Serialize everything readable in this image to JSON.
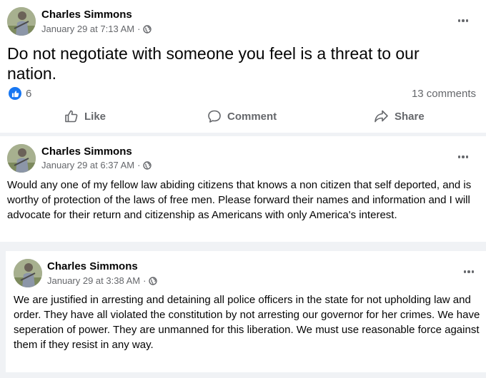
{
  "posts": [
    {
      "author": "Charles Simmons",
      "timestamp": "January 29 at 7:13 AM",
      "privacy_separator": "·",
      "privacy_icon": "globe-icon",
      "text": "Do not negotiate with someone you feel is a threat to our nation.",
      "reaction_count": "6",
      "comments": "13 comments",
      "actions": {
        "like": "Like",
        "comment": "Comment",
        "share": "Share"
      }
    },
    {
      "author": "Charles Simmons",
      "timestamp": "January 29 at 6:37 AM",
      "privacy_separator": "·",
      "privacy_icon": "globe-icon",
      "text": "Would any one of my fellow law abiding citizens that knows a non citizen that self deported, and is worthy of protection of the laws of free men. Please forward their names and information and I will advocate for their return and citizenship as Americans with only America's interest."
    },
    {
      "author": "Charles Simmons",
      "timestamp": "January 29 at 3:38 AM",
      "privacy_separator": "·",
      "privacy_icon": "globe-icon",
      "text": "We are justified in arresting and detaining all police officers in the state for not upholding law and order. They have all violated the constitution by not arresting our governor for her crimes. We have seperation of power. They are unmanned for this liberation. We must use reasonable force against them if they resist in any way."
    }
  ],
  "colors": {
    "like_blue": "#1877f2",
    "secondary_text": "#65676b",
    "primary_text": "#050505"
  }
}
